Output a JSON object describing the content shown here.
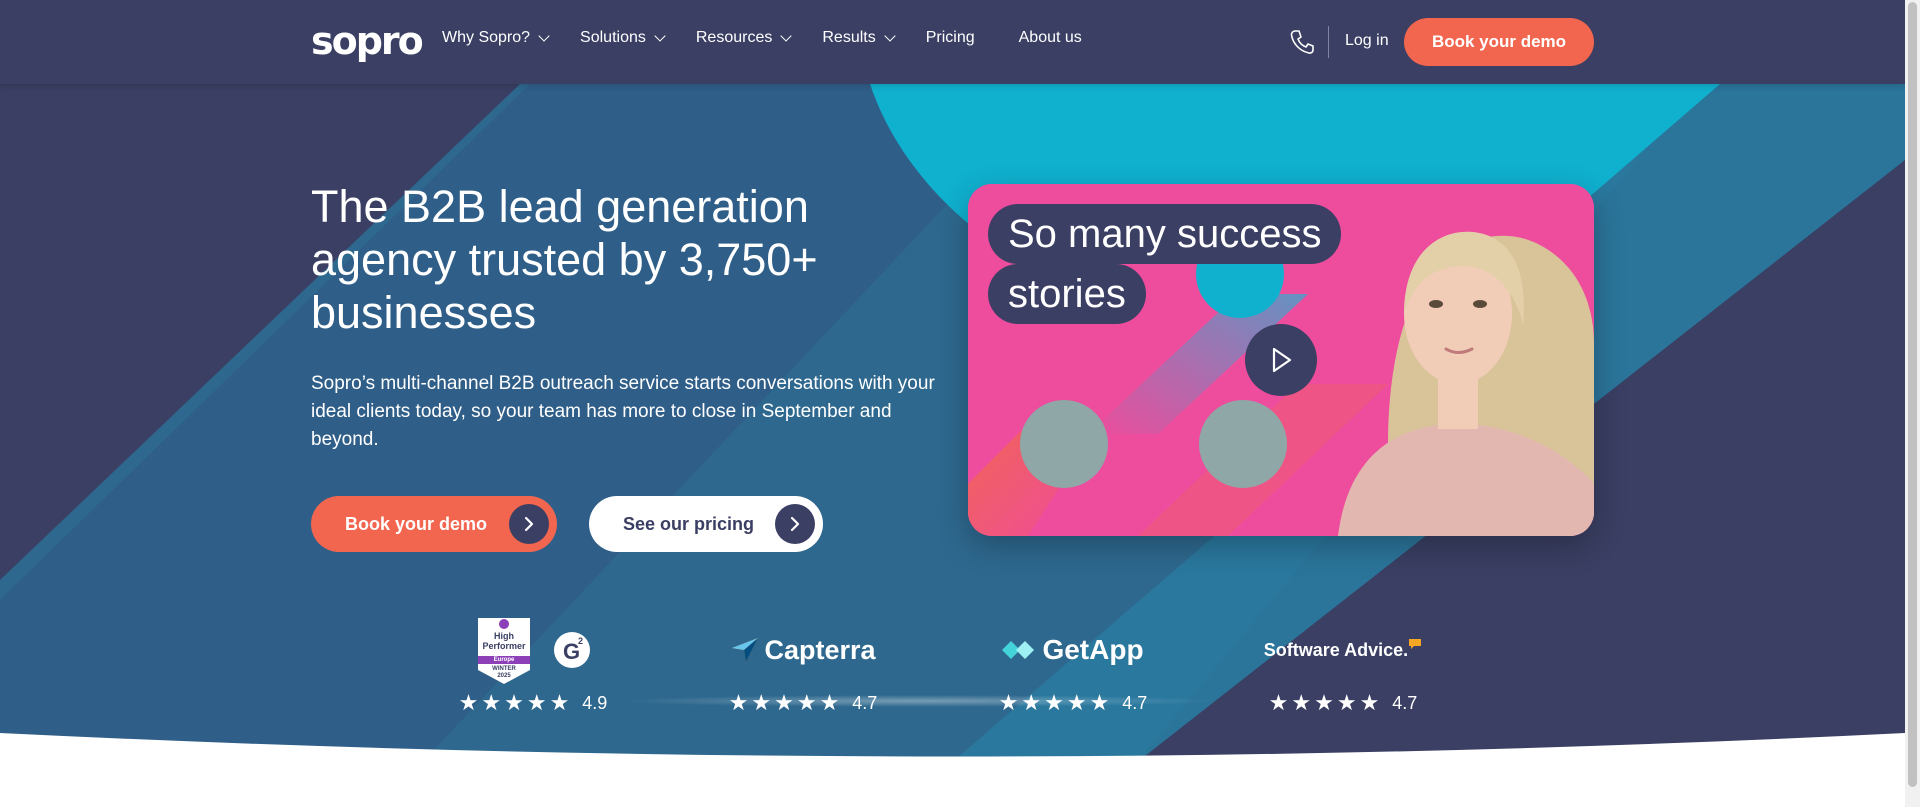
{
  "brand": {
    "logo_text": "sopro"
  },
  "nav": {
    "items": [
      {
        "label": "Why Sopro?",
        "dropdown": true
      },
      {
        "label": "Solutions",
        "dropdown": true
      },
      {
        "label": "Resources",
        "dropdown": true
      },
      {
        "label": "Results",
        "dropdown": true
      },
      {
        "label": "Pricing",
        "dropdown": false
      },
      {
        "label": "About us",
        "dropdown": false
      }
    ],
    "phone_icon": "phone-icon",
    "login_label": "Log in",
    "cta_label": "Book your demo"
  },
  "hero": {
    "title": "The B2B lead generation agency trusted by 3,750+ businesses",
    "subtitle": "Sopro’s multi-channel B2B outreach service starts conversations with your ideal clients today, so your team has more to close in September and beyond.",
    "primary_button": "Book your demo",
    "secondary_button": "See our pricing"
  },
  "video": {
    "caption_line1": "So many success",
    "caption_line2": "stories",
    "play_icon": "play-icon"
  },
  "reviews": [
    {
      "platform": "G2",
      "badge_line1": "High",
      "badge_line2": "Performer",
      "badge_region": "Europe",
      "badge_season": "WINTER",
      "badge_year": "2025",
      "rating": "4.9",
      "stars": "★★★★★"
    },
    {
      "platform": "Capterra",
      "rating": "4.7",
      "stars": "★★★★★"
    },
    {
      "platform": "GetApp",
      "rating": "4.7",
      "stars": "★★★★★"
    },
    {
      "platform": "Software Advice.",
      "rating": "4.7",
      "stars": "★★★★★"
    }
  ],
  "colors": {
    "navy": "#3a3f63",
    "teal": "#0fb0cf",
    "coral": "#f26650",
    "pink": "#ee4c9c"
  }
}
